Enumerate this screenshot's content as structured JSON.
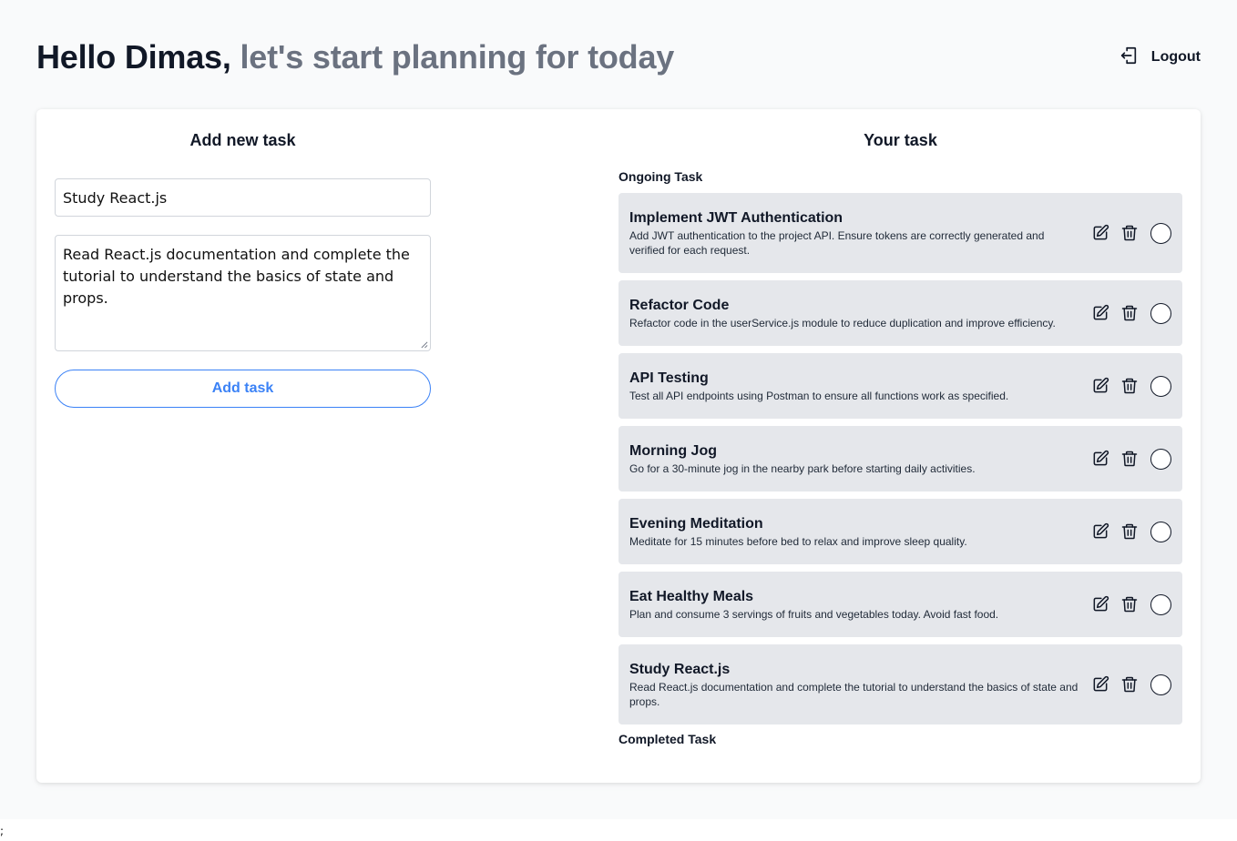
{
  "header": {
    "greeting_name": "Hello Dimas,",
    "greeting_sub": "let's start planning for today",
    "logout_label": "Logout",
    "logout_icon": "logout-icon"
  },
  "add_panel": {
    "title": "Add new task",
    "title_value": "Study React.js",
    "description_value": "Read React.js documentation and complete the tutorial to understand the basics of state and props.",
    "button_label": "Add task"
  },
  "task_panel": {
    "title": "Your task",
    "ongoing_label": "Ongoing Task",
    "completed_label": "Completed Task",
    "tasks": [
      {
        "title": "Implement JWT Authentication",
        "description": "Add JWT authentication to the project API. Ensure tokens are correctly generated and verified for each request."
      },
      {
        "title": "Refactor Code",
        "description": "Refactor code in the userService.js module to reduce duplication and improve efficiency."
      },
      {
        "title": "API Testing",
        "description": "Test all API endpoints using Postman to ensure all functions work as specified."
      },
      {
        "title": "Morning Jog",
        "description": "Go for a 30-minute jog in the nearby park before starting daily activities."
      },
      {
        "title": "Evening Meditation",
        "description": "Meditate for 15 minutes before bed to relax and improve sleep quality."
      },
      {
        "title": "Eat Healthy Meals",
        "description": "Plan and consume 3 servings of fruits and vegetables today. Avoid fast food."
      },
      {
        "title": "Study React.js",
        "description": "Read React.js documentation and complete the tutorial to understand the basics of state and props."
      }
    ]
  },
  "stray_text": ";",
  "colors": {
    "accent": "#3b82f6",
    "task_bg": "#e5e7eb",
    "page_bg": "#f9fafb",
    "muted_text": "#6b7280"
  }
}
